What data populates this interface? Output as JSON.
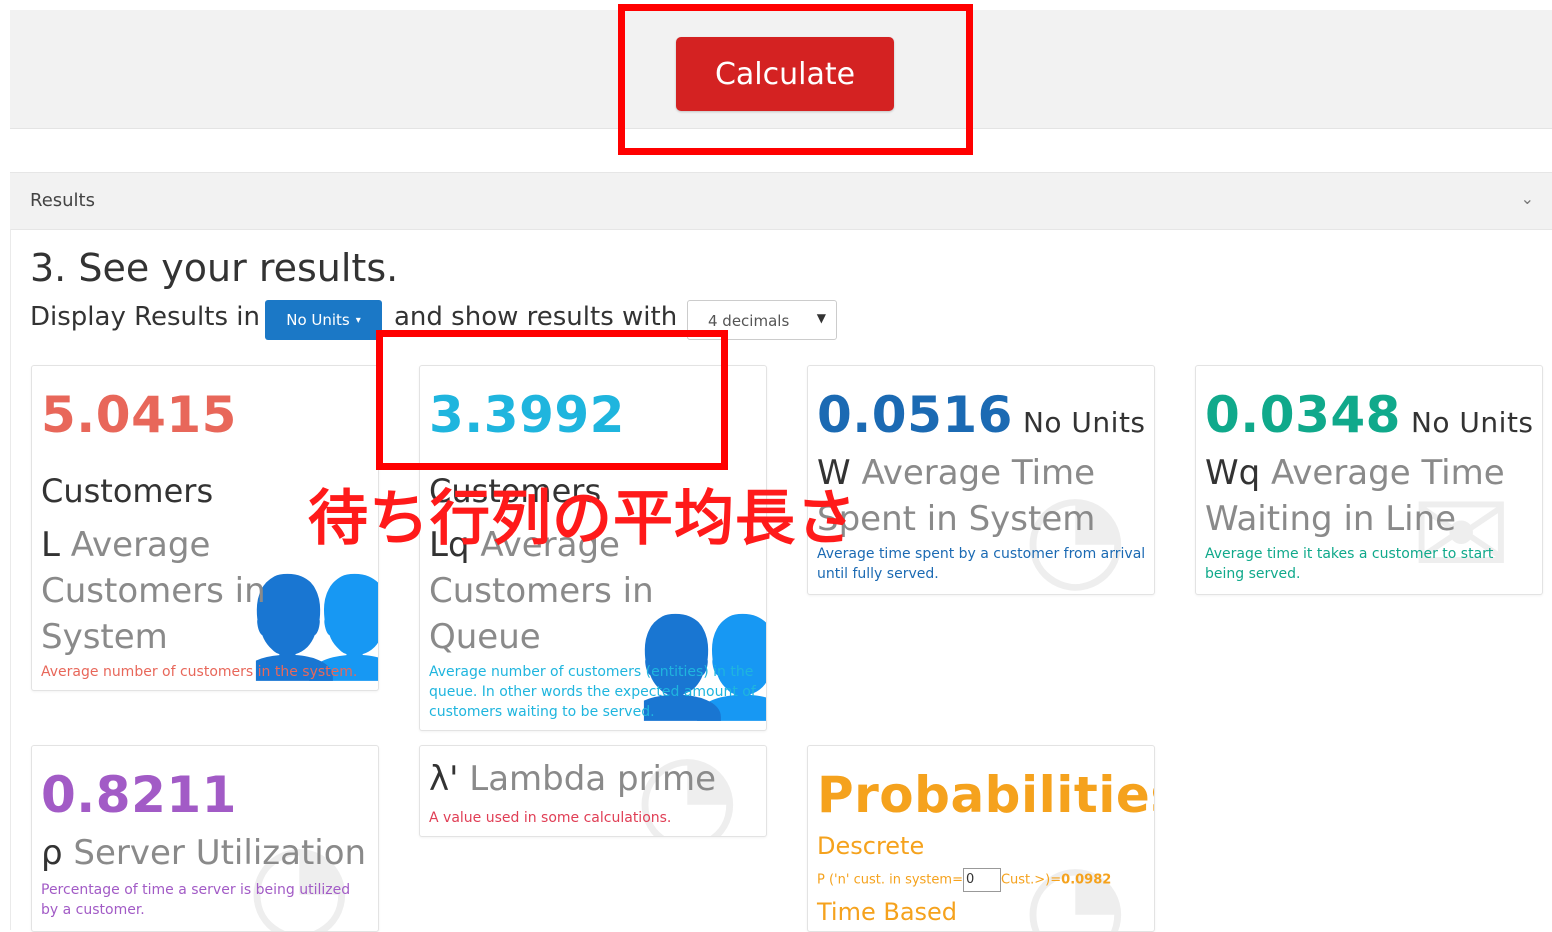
{
  "calculate": {
    "label": "Calculate"
  },
  "results": {
    "header": "Results",
    "chevron": "⌄",
    "step_title": "3. See your results.",
    "display_prefix": "Display Results in",
    "units_button": "No Units",
    "show_text": "and show results with",
    "decimals_select": "4 decimals",
    "decimals_arrow": "▼"
  },
  "overlay_annotation": "待ち行列の平均長さ",
  "cards": {
    "L": {
      "value": "5.0415",
      "sublabel": "Customers",
      "symbol": "L",
      "title": "Average Customers in System",
      "desc": "Average number of customers in the system.",
      "color": "#e8675a"
    },
    "Lq": {
      "value": "3.3992",
      "sublabel": "Customers",
      "symbol": "Lq",
      "title": "Average Customers in Queue",
      "desc": "Average number of customers (entities) in the queue. In other words the expected amount of customers waiting to be served.",
      "color": "#1fb5de"
    },
    "W": {
      "value": "0.0516",
      "unit": "No Units",
      "symbol": "W",
      "title": "Average Time Spent in System",
      "desc": "Average time spent by a customer from arrival until fully served.",
      "color": "#1b6ab3"
    },
    "Wq": {
      "value": "0.0348",
      "unit": "No Units",
      "symbol": "Wq",
      "title": "Average Time Waiting in Line",
      "desc": "Average time it takes a customer to start being served.",
      "color": "#10a98b"
    },
    "rho": {
      "value": "0.8211",
      "symbol": "ρ",
      "title": "Server Utilization",
      "desc": "Percentage of time a server is being utilized by a customer.",
      "color": "#a25bc6"
    },
    "lambda": {
      "symbol": "λ'",
      "title": "Lambda prime",
      "desc": "A value used in some calculations.",
      "color": "#e03e55"
    },
    "prob": {
      "title": "Probabilities",
      "discrete": "Descrete",
      "p_prefix": "P ('n' cust. in system=",
      "p_input": "0",
      "p_suffix": "Cust.>)=",
      "p_value": "0.0982",
      "time_based": "Time Based",
      "color": "#f5a21d"
    }
  }
}
